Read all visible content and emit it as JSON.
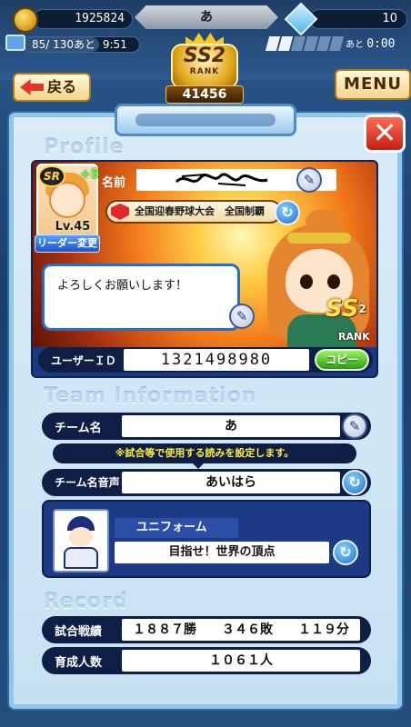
{
  "hud": {
    "coins": "1925824",
    "player_name": "あ",
    "gems": "10",
    "stamina": "85/ 130あと",
    "stamina_timer": "9:51",
    "stamina_fraction": 0.654,
    "rank_label": "RANK",
    "rank_tier": "SS2",
    "rank_score": "41456",
    "meter_segments_on": 2,
    "meter_segments_total": 6,
    "timer_prefix": "あと",
    "timer_value": "0:00",
    "back_label": "戻る",
    "menu_label": "MENU"
  },
  "panel": {
    "close_label": "✕",
    "profile_title": "Profile",
    "team_title": "Team Information",
    "record_title": "Record"
  },
  "profile": {
    "rarity_badge": "SR",
    "bonus": "+5",
    "level": "Lv.45",
    "leader_change": "リーダー変更",
    "name_label": "名前",
    "title_text": "全国迎春野球大会　全国制覇",
    "message": "よろしくお願いします！",
    "rank_tier": "SS",
    "rank_sub": "2",
    "rank_text": "RANK",
    "user_id_label": "ユーザーＩＤ",
    "user_id": "1321498980",
    "copy_label": "コピー"
  },
  "team": {
    "name_label": "チーム名",
    "name_value": "あ",
    "notice": "※試合等で使用する読みを設定します。",
    "voice_label": "チーム名音声",
    "voice_value": "あいはら",
    "uniform_label": "ユニフォーム",
    "uniform_value": "目指せ！世界の頂点"
  },
  "record": {
    "match_label": "試合戦績",
    "match_value": "１８８７勝　　３４６敗　　１１９分",
    "trained_label": "育成人数",
    "trained_value": "１０６１人"
  },
  "colors": {
    "panel_bg": "#d9ecf8",
    "row_bg": "#0f1e45",
    "accent_blue": "#1a6fd1",
    "close_red": "#c81d12",
    "copy_green": "#2a9d16"
  },
  "icons": {
    "coin": "coin-icon",
    "gem": "gem-icon",
    "edit": "pen-icon",
    "refresh": "refresh-icon",
    "back": "back-arrow-icon",
    "close": "close-icon"
  }
}
